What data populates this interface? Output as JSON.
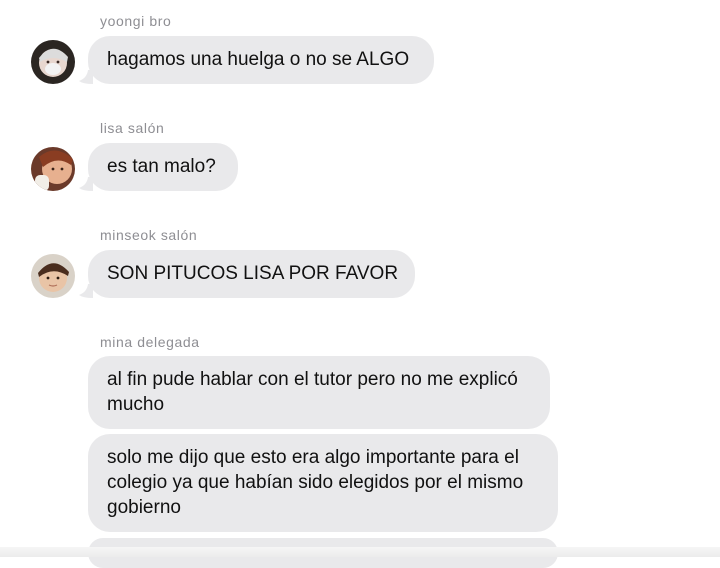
{
  "messages": [
    {
      "sender": "yoongi bro",
      "avatar_icon": "avatar-yoongi",
      "bubbles": [
        "hagamos una huelga o no se ALGO"
      ]
    },
    {
      "sender": "lisa salón",
      "avatar_icon": "avatar-lisa",
      "bubbles": [
        "es tan malo?"
      ]
    },
    {
      "sender": "minseok salón",
      "avatar_icon": "avatar-minseok",
      "bubbles": [
        "SON PITUCOS LISA POR FAVOR"
      ]
    },
    {
      "sender": "mina delegada",
      "bubbles": [
        "al fin pude hablar con el tutor pero no me explicó mucho",
        "solo me dijo que esto era algo importante para el colegio ya que habían sido elegidos por el mismo gobierno"
      ]
    }
  ],
  "colors": {
    "bubble": "#e9e9eb",
    "sender_text": "#8e8e93",
    "message_text": "#111111"
  }
}
